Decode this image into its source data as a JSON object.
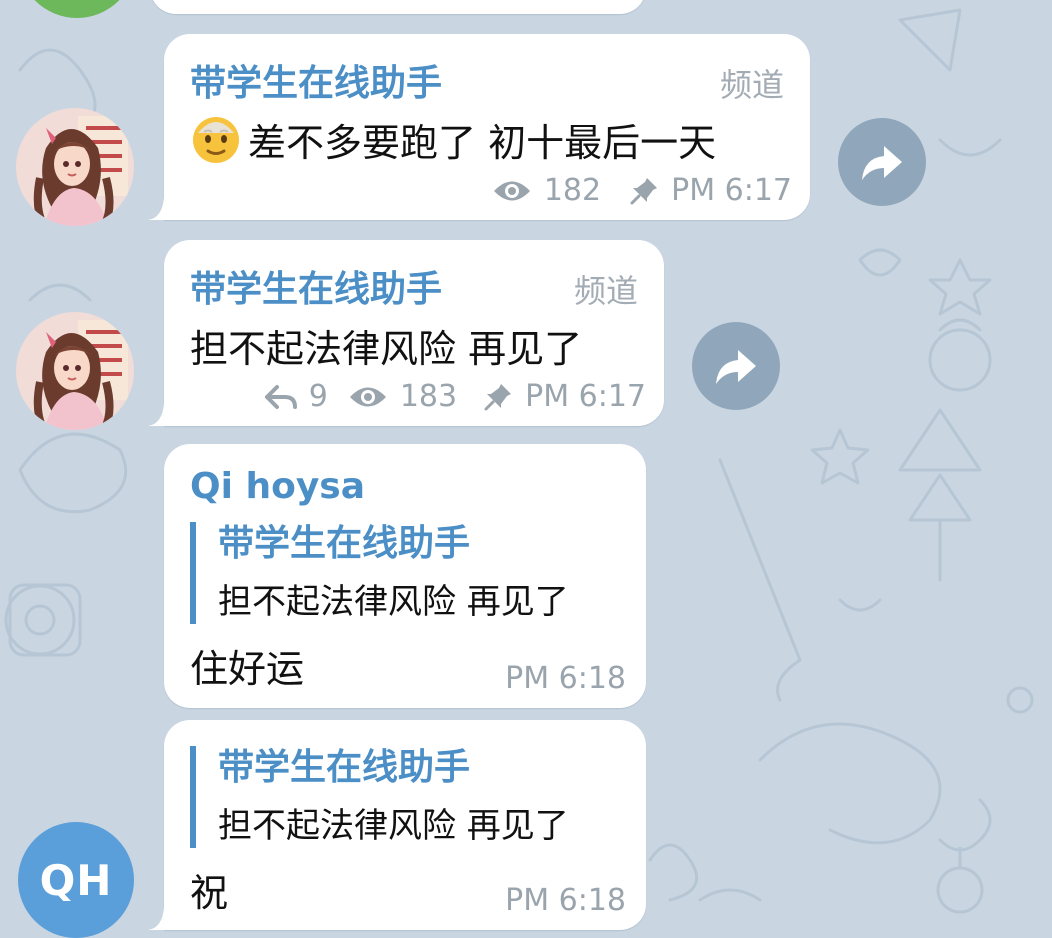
{
  "colors": {
    "background": "#c9d6e2",
    "sender_name": "#4b8fc6",
    "meta_text": "#9aa4ad",
    "avatar_qh": "#5a9fd9"
  },
  "messages": [
    {
      "sender": "带学生在线助手",
      "tag": "频道",
      "emoji": "older-man-emoji",
      "text": "差不多要跑了 初十最后一天",
      "views": "182",
      "time": "PM 6:17",
      "pinned": true
    },
    {
      "sender": "带学生在线助手",
      "tag": "频道",
      "text": "担不起法律风险 再见了",
      "replies": "9",
      "views": "183",
      "time": "PM 6:17",
      "pinned": true
    },
    {
      "sender": "Qi hoysa",
      "quote_title": "带学生在线助手",
      "quote_text": "担不起法律风险 再见了",
      "text": "住好运",
      "time": "PM 6:18"
    },
    {
      "quote_title": "带学生在线助手",
      "quote_text": "担不起法律风险 再见了",
      "text": "祝",
      "time": "PM 6:18"
    }
  ],
  "avatar_initials": "QH"
}
